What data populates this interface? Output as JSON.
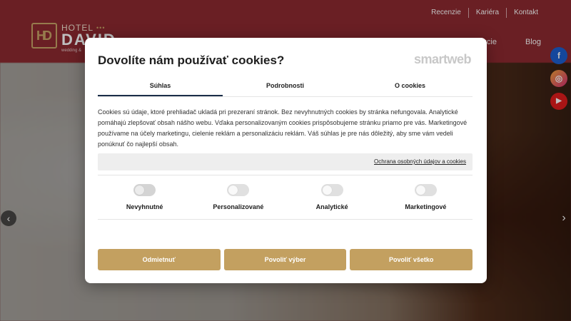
{
  "header": {
    "top_links": [
      "Recenzie",
      "Kariéra",
      "Kontakt"
    ],
    "logo": {
      "monogram": "HD",
      "hotel": "HOTEL",
      "dots": "•••",
      "name": "DAVID",
      "tagline": "wedding &"
    },
    "nav": [
      "Akcie",
      "Blog"
    ]
  },
  "social": {
    "facebook": "f",
    "instagram": "◎",
    "youtube": "▶"
  },
  "slider": {
    "prev": "‹",
    "next": "›"
  },
  "cookie_dialog": {
    "title": "Dovolíte nám používať cookies?",
    "brand": "smartweb",
    "tabs": [
      "Súhlas",
      "Podrobnosti",
      "O cookies"
    ],
    "active_tab": "Súhlas",
    "description": "Cookies sú údaje, ktoré prehliadač ukladá pri prezeraní stránok. Bez nevyhnutných cookies by stránka nefungovala. Analytické pomáhajú zlepšovať obsah nášho webu. Vďaka personalizovaným cookies prispôsobujeme stránku priamo pre vás. Marketingové používame na účely marketingu, cielenie reklám a personalizáciu reklám. Váš súhlas je pre nás dôležitý, aby sme vám vedeli ponúknuť čo najlepší obsah.",
    "privacy_link": "Ochrana osobných údajov a cookies",
    "toggles": [
      {
        "label": "Nevyhnutné",
        "enabled": false,
        "disabled": true
      },
      {
        "label": "Personalizované",
        "enabled": false,
        "disabled": false
      },
      {
        "label": "Analytické",
        "enabled": false,
        "disabled": false
      },
      {
        "label": "Marketingové",
        "enabled": false,
        "disabled": false
      }
    ],
    "buttons": [
      "Odmietnuť",
      "Povoliť výber",
      "Povoliť všetko"
    ],
    "button_color": "#c3a060"
  },
  "colors": {
    "header_bg": "#8e2a31",
    "gold": "#c9a567"
  }
}
